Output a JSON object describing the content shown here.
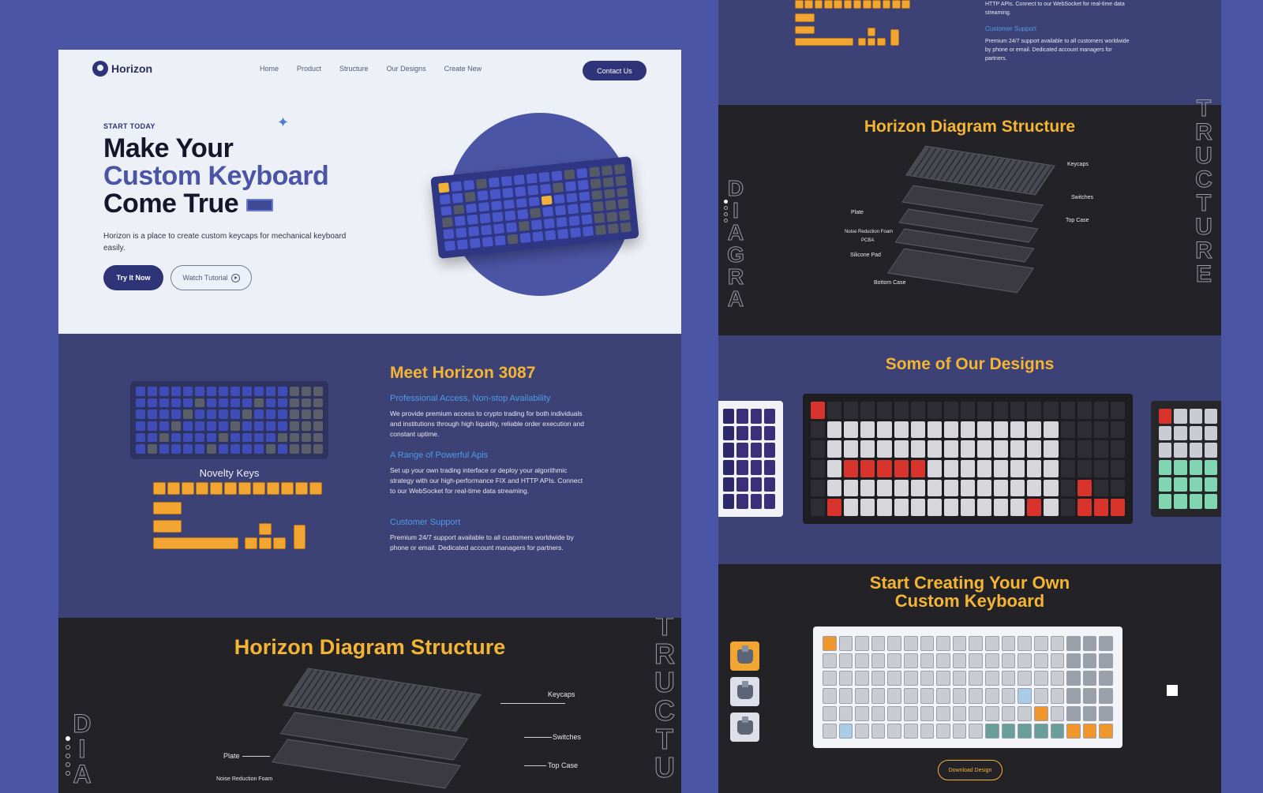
{
  "brand": {
    "name": "Horizon"
  },
  "nav": {
    "items": [
      "Home",
      "Product",
      "Structure",
      "Our Designs",
      "Create New"
    ],
    "cta": "Contact Us"
  },
  "hero": {
    "eyebrow": "START TODAY",
    "title_line1": "Make Your",
    "title_line2": "Custom Keyboard",
    "title_line3": "Come True",
    "description": "Horizon is a place to create custom keycaps for mechanical keyboard easily.",
    "primary_button": "Try It Now",
    "secondary_button": "Watch Tutorial"
  },
  "meet": {
    "title": "Meet Horizon 3087",
    "novelty_label": "Novelty Keys",
    "features": [
      {
        "title": "Professional Access, Non-stop Availability",
        "text": "We provide premium access to crypto trading for both individuals and institutions through high liquidity, reliable order execution and constant uptime."
      },
      {
        "title": "A Range of Powerful Apis",
        "text": "Set up your own trading interface or deploy your algorithmic strategy with our high-performance FIX and HTTP APIs. Connect to our WebSocket for real-time data streaming."
      },
      {
        "title": "Customer Support",
        "text": "Premium 24/7 support available to all customers worldwide by phone or email. Dedicated account managers for partners."
      }
    ]
  },
  "diagram": {
    "title": "Horizon Diagram Structure",
    "ghost_left": "DIAGRA",
    "ghost_right": "TRUCTURE",
    "callouts": [
      "Keycaps",
      "Switches",
      "Plate",
      "Top Case",
      "Noise Reduction Foam",
      "PCBA",
      "Silicone Pad",
      "Bottom Case"
    ]
  },
  "right_top": {
    "api_text": "HTTP APIs. Connect to our WebSocket for real-time data streaming.",
    "support_title": "Customer Support",
    "support_text": "Premium 24/7 support available to all customers worldwide by phone or email. Dedicated account managers for partners."
  },
  "designs": {
    "title": "Some of Our Designs"
  },
  "create": {
    "title_line1": "Start Creating Your Own",
    "title_line2": "Custom Keyboard",
    "download_button": "Download Design"
  },
  "colors": {
    "background": "#4b55a5",
    "navy": "#2f3478",
    "accent_yellow": "#f5b534",
    "accent_blue": "#4f9bea",
    "dark_section": "#222227",
    "mid_section": "#3c4275"
  }
}
